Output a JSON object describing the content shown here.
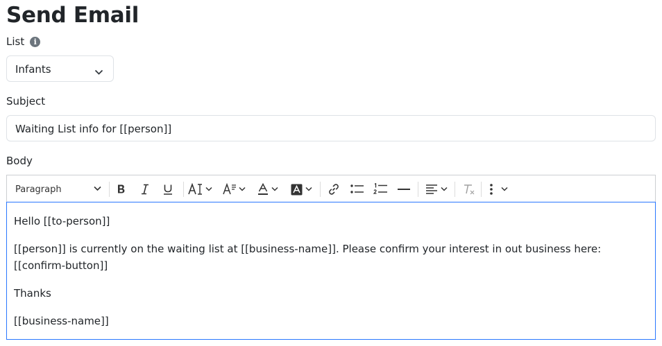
{
  "page": {
    "title": "Send Email"
  },
  "list": {
    "label": "List",
    "info_icon": "info-circle-icon",
    "selected": "Infants"
  },
  "subject": {
    "label": "Subject",
    "value": "Waiting List info for [[person]]"
  },
  "body": {
    "label": "Body",
    "toolbar": {
      "paragraph_label": "Paragraph",
      "icons": [
        "bold-icon",
        "italic-icon",
        "underline-icon",
        "font-size-icon",
        "font-family-icon",
        "font-color-icon",
        "font-background-color-icon",
        "link-icon",
        "bulleted-list-icon",
        "numbered-list-icon",
        "horizontal-line-icon",
        "text-alignment-icon",
        "remove-format-icon",
        "more-options-icon"
      ]
    },
    "paragraphs": {
      "p1": "Hello [[to-person]]",
      "p2": "[[person]] is currently on the waiting list at [[business-name]].  Please confirm your interest in out business here: [[confirm-button]]",
      "p3": "Thanks",
      "p4": "[[business-name]]"
    }
  },
  "colors": {
    "focus_border": "#2977ff",
    "border": "#dee2e6",
    "text": "#212529"
  }
}
